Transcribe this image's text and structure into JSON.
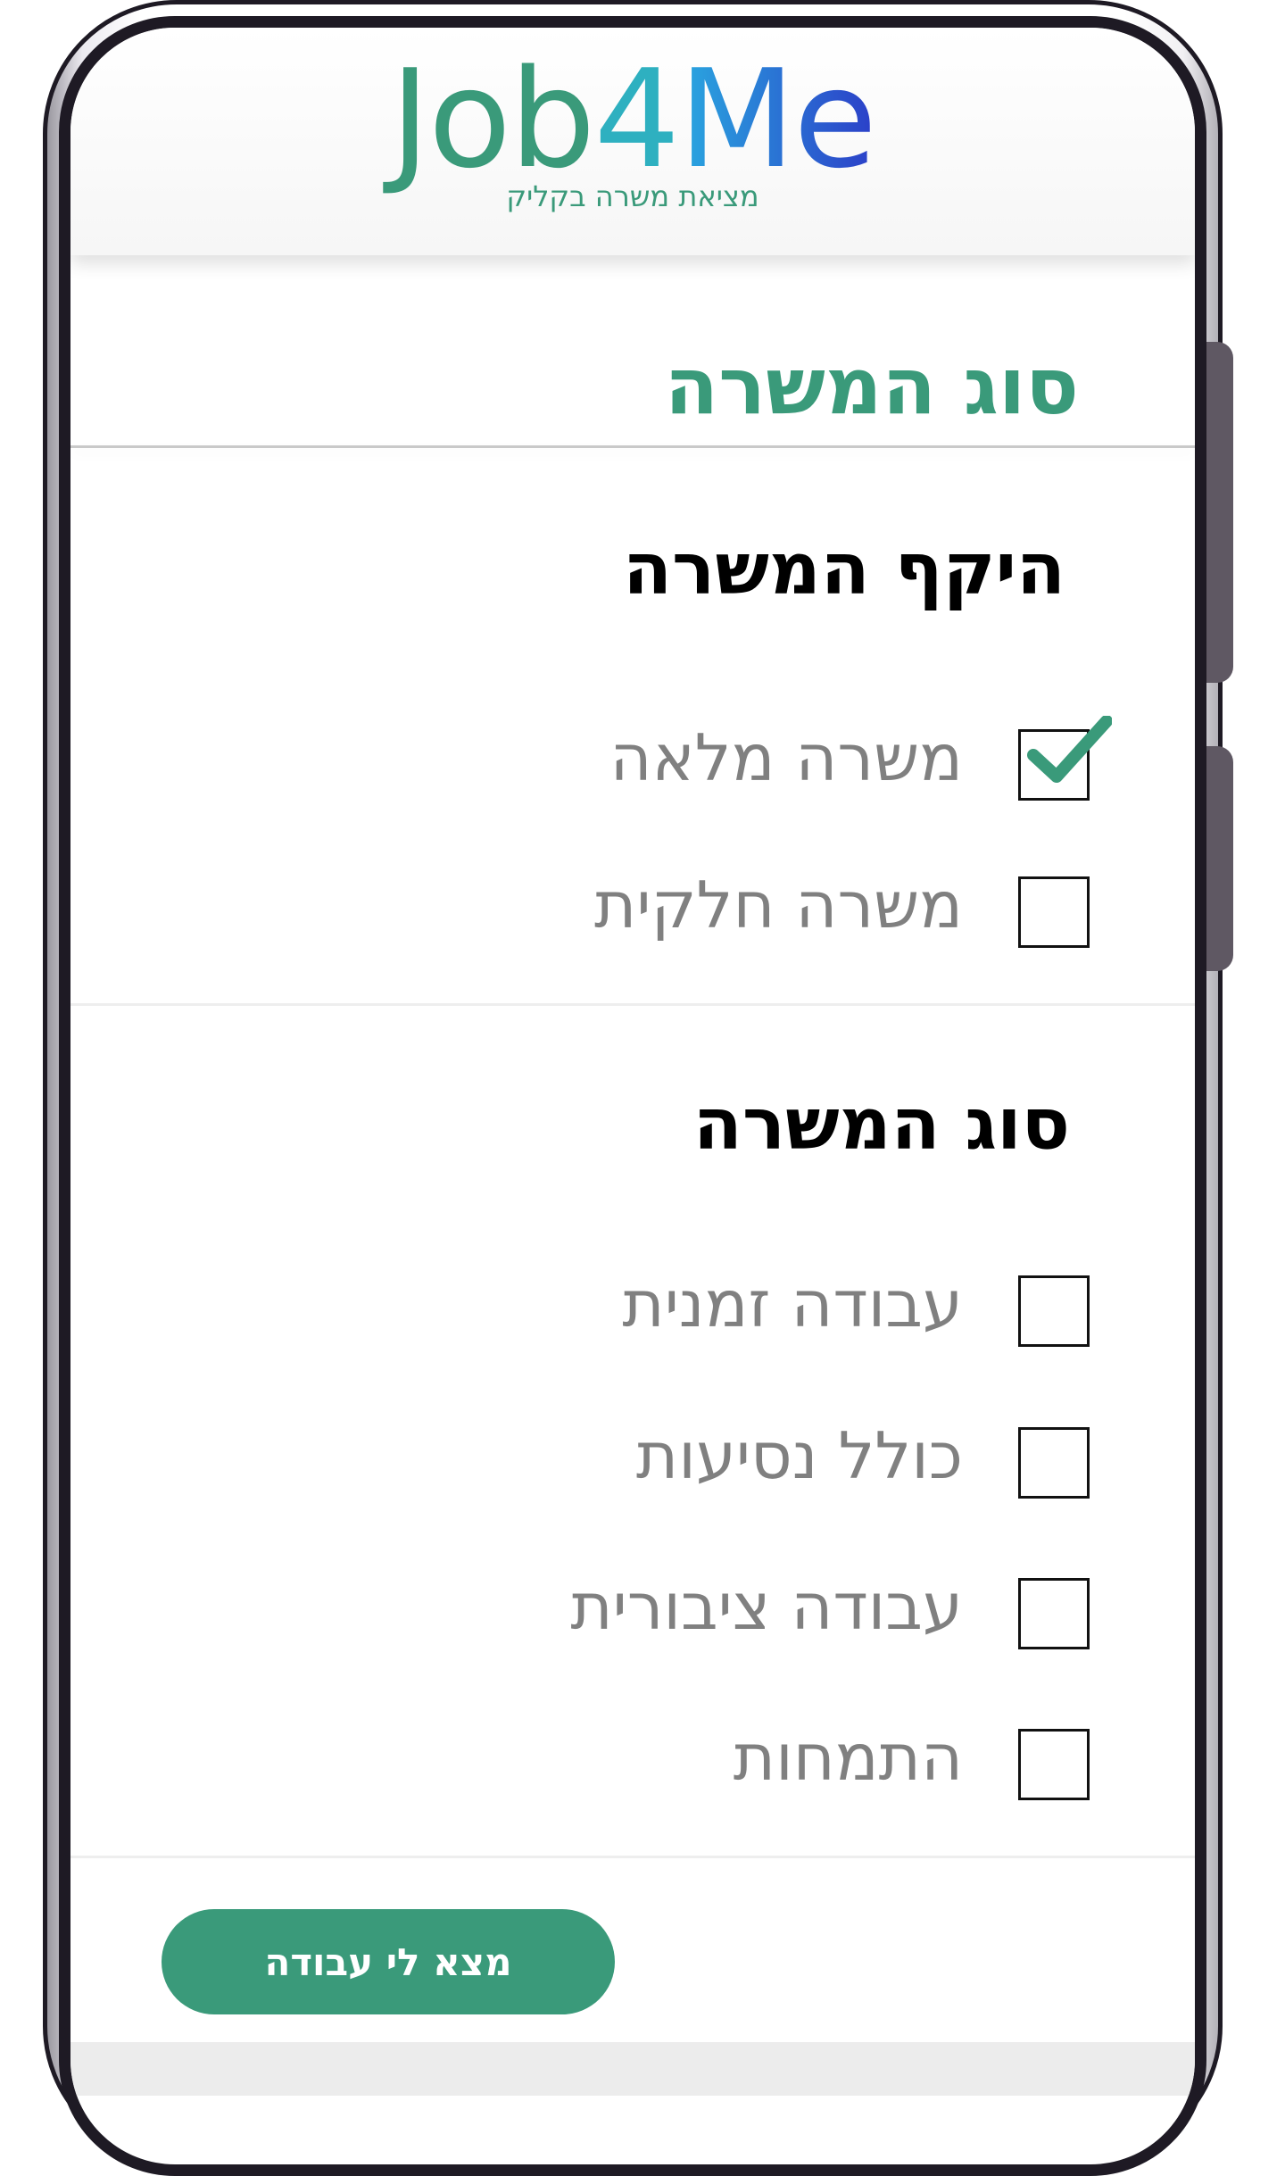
{
  "app": {
    "logo_job": "Job",
    "logo_four": "4",
    "logo_me": "Me",
    "tagline": "מציאת משרה בקליק"
  },
  "page": {
    "title": "סוג המשרה"
  },
  "scope_group": {
    "title": "היקף המשרה",
    "options": [
      {
        "label": "משרה מלאה",
        "checked": true
      },
      {
        "label": "משרה חלקית",
        "checked": false
      }
    ]
  },
  "type_group": {
    "title": "סוג המשרה",
    "options": [
      {
        "label": "עבודה זמנית",
        "checked": false
      },
      {
        "label": "כולל נסיעות",
        "checked": false
      },
      {
        "label": "עבודה ציבורית",
        "checked": false
      },
      {
        "label": "התמחות",
        "checked": false
      }
    ]
  },
  "actions": {
    "find_label": "מצא לי עבודה"
  },
  "colors": {
    "brand_green": "#3a9a7a",
    "brand_blue": "#2b3fc8",
    "frame": "#1e1a24"
  }
}
